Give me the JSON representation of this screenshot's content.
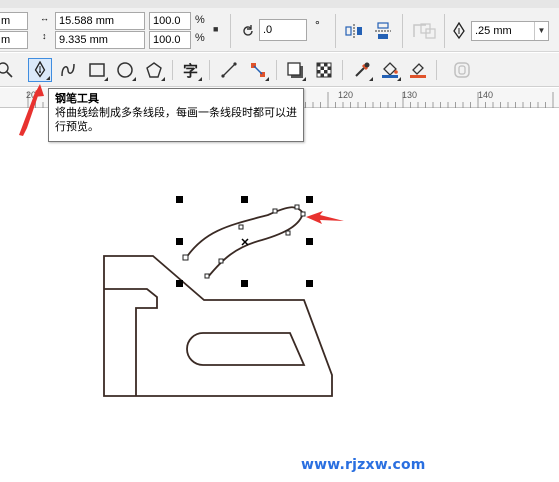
{
  "property_bar": {
    "x_value_partial": "m",
    "y_value_partial": "m",
    "width_value": "15.588 mm",
    "height_value": "9.335 mm",
    "scale_x": "100.0",
    "scale_y": "100.0",
    "percent_symbol": "%",
    "rotation_value": ".0",
    "degree_symbol": "°",
    "outline_width": ".25 mm"
  },
  "tooltip": {
    "title": "钢笔工具",
    "description": "将曲线绘制成多条线段，每画一条线段时都可以进行预览。"
  },
  "ruler": {
    "labels": [
      "20",
      "120",
      "130",
      "140"
    ]
  },
  "watermark": "www.rjzxw.com",
  "colors": {
    "selected_tool_border": "#3f8de0",
    "annotation_arrow": "#e8322f",
    "watermark": "#2a6fe0",
    "curve_stroke": "#3a2a24"
  }
}
